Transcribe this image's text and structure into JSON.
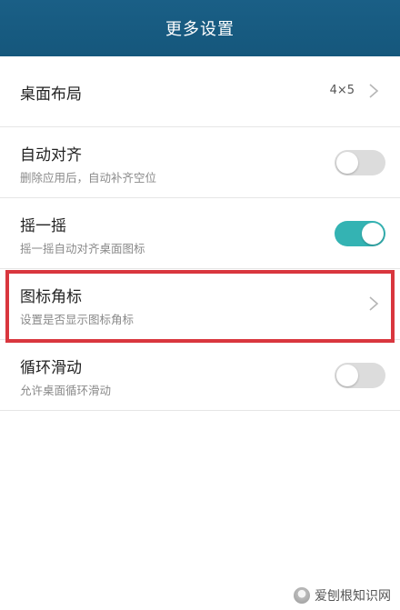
{
  "header": {
    "title": "更多设置"
  },
  "settings": {
    "desktop_layout": {
      "title": "桌面布局",
      "value": "4×5"
    },
    "auto_align": {
      "title": "自动对齐",
      "subtitle": "删除应用后，自动补齐空位",
      "enabled": false
    },
    "shake": {
      "title": "摇一摇",
      "subtitle": "摇一摇自动对齐桌面图标",
      "enabled": true
    },
    "icon_badge": {
      "title": "图标角标",
      "subtitle": "设置是否显示图标角标"
    },
    "loop_scroll": {
      "title": "循环滑动",
      "subtitle": "允许桌面循环滑动",
      "enabled": false
    }
  },
  "colors": {
    "header_bg": "#15577c",
    "toggle_on": "#34b3b3",
    "toggle_off": "#dcdcdc",
    "highlight": "#d9363e"
  },
  "watermark": {
    "text": "爱刨根知识网"
  }
}
